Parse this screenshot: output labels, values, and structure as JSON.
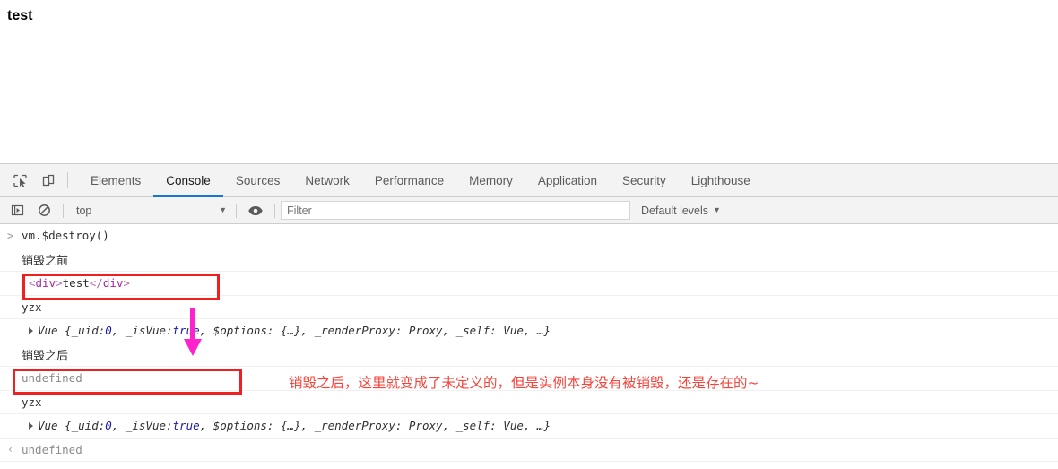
{
  "page": {
    "rendered_text": "test"
  },
  "devtools": {
    "tabstrip": {
      "inspect_icon": "inspect-element-icon",
      "device_icon": "device-toolbar-icon",
      "tabs": [
        {
          "label": "Elements",
          "active": false
        },
        {
          "label": "Console",
          "active": true
        },
        {
          "label": "Sources",
          "active": false
        },
        {
          "label": "Network",
          "active": false
        },
        {
          "label": "Performance",
          "active": false
        },
        {
          "label": "Memory",
          "active": false
        },
        {
          "label": "Application",
          "active": false
        },
        {
          "label": "Security",
          "active": false
        },
        {
          "label": "Lighthouse",
          "active": false
        }
      ]
    },
    "console_toolbar": {
      "sidebar_icon": "console-sidebar-icon",
      "clear_icon": "clear-console-icon",
      "eye_icon": "live-expression-eye-icon",
      "context_value": "top",
      "context_caret": "▼",
      "filter_placeholder": "Filter",
      "filter_value": "",
      "levels_label": "Default levels",
      "levels_caret": "▼"
    },
    "console_rows": [
      {
        "gutter": ">",
        "kind": "input",
        "text": "vm.$destroy()"
      },
      {
        "gutter": "",
        "kind": "cjk",
        "text": "销毁之前"
      },
      {
        "gutter": "",
        "kind": "htmlnode",
        "open_bracket": "<",
        "open_tag": "div",
        "open_close": ">",
        "inner": "test",
        "close_bracket": "</",
        "close_tag": "div",
        "close_close": ">"
      },
      {
        "gutter": "",
        "kind": "plain",
        "text": "yzx"
      },
      {
        "gutter": "",
        "kind": "object",
        "prefix": "Vue {_uid: ",
        "num": "0",
        "mid": ", _isVue: ",
        "bool": "true",
        "suffix": ", $options: {…}, _renderProxy: Proxy, _self: Vue, …}"
      },
      {
        "gutter": "",
        "kind": "cjk",
        "text": "销毁之后"
      },
      {
        "gutter": "",
        "kind": "muted",
        "text": "undefined"
      },
      {
        "gutter": "",
        "kind": "plain",
        "text": "yzx"
      },
      {
        "gutter": "",
        "kind": "object",
        "prefix": "Vue {_uid: ",
        "num": "0",
        "mid": ", _isVue: ",
        "bool": "true",
        "suffix": ", $options: {…}, _renderProxy: Proxy, _self: Vue, …}"
      },
      {
        "gutter": "‹",
        "kind": "result",
        "text": "undefined"
      }
    ]
  },
  "annotations": {
    "box1_name": "highlight-box-div-test",
    "box2_name": "highlight-box-undefined",
    "arrow_name": "magenta-down-arrow",
    "note_text": "销毁之后，这里就变成了未定义的，但是实例本身没有被销毁，还是存在的~",
    "colors": {
      "box_red": "#f02020",
      "note_red": "#f5453b",
      "arrow_magenta": "#ff22cc",
      "active_tab_blue": "#1676d1"
    }
  }
}
